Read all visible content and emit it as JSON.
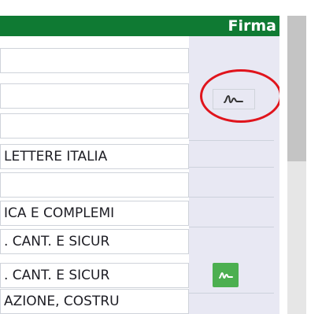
{
  "header": {
    "label": "Firma",
    "bar_color": "#0f7a33"
  },
  "rows": [
    {
      "text": ""
    },
    {
      "text": ""
    },
    {
      "text": ""
    },
    {
      "text": " LETTERE ITALIA"
    },
    {
      "text": ""
    },
    {
      "text": "ICA E COMPLEMI"
    },
    {
      "text": ". CANT. E SICUR"
    },
    {
      "text": ". CANT. E SICUR"
    },
    {
      "text": "AZIONE, COSTRU"
    }
  ],
  "signature_icon": "signature-icon",
  "colors": {
    "sign_button_green": "#4caf50",
    "highlight_ring": "#e0141c"
  }
}
